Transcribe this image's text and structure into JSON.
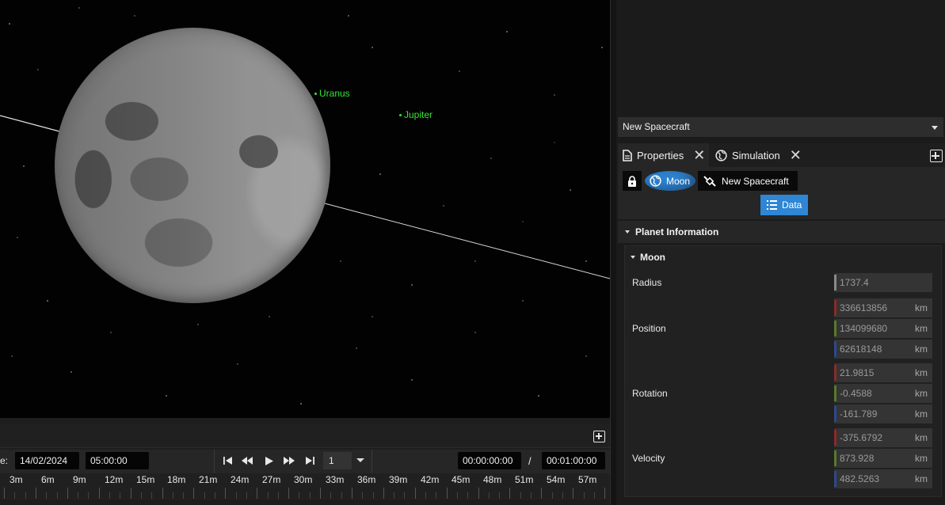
{
  "viewport": {
    "labels": [
      {
        "text": "Uranus"
      },
      {
        "text": "Jupiter"
      }
    ]
  },
  "timeline": {
    "date_label": "e:",
    "date": "14/02/2024",
    "time": "05:00:00",
    "speed": "1",
    "current_time": "00:00:00:00",
    "separator": "/",
    "end_time": "00:01:00:00",
    "ticks": [
      "3m",
      "6m",
      "9m",
      "12m",
      "15m",
      "18m",
      "21m",
      "24m",
      "27m",
      "30m",
      "33m",
      "36m",
      "39m",
      "42m",
      "45m",
      "48m",
      "51m",
      "54m",
      "57m"
    ]
  },
  "right_panel": {
    "spacecraft_dropdown": "New Spacecraft",
    "tabs": [
      {
        "label": "Properties",
        "icon": "document-icon"
      },
      {
        "label": "Simulation",
        "icon": "globe-icon"
      }
    ],
    "object_buttons": {
      "moon": "Moon",
      "spacecraft": "New Spacecraft"
    },
    "data_button": "Data",
    "section_title": "Planet Information",
    "subsection_title": "Moon",
    "fields": {
      "radius": {
        "label": "Radius",
        "value": "1737.4"
      },
      "position": {
        "label": "Position",
        "x": "336613856",
        "y": "134099680",
        "z": "62618148",
        "unit": "km"
      },
      "rotation": {
        "label": "Rotation",
        "x": "21.9815",
        "y": "-0.4588",
        "z": "-161.789",
        "unit": "km"
      },
      "velocity": {
        "label": "Velocity",
        "x": "-375.6792",
        "y": "873.928",
        "z": "482.5263",
        "unit": "km"
      }
    },
    "axis_colors": {
      "x": "#8c2a2a",
      "y": "#5a7a2a",
      "z": "#2a4a8c"
    }
  }
}
